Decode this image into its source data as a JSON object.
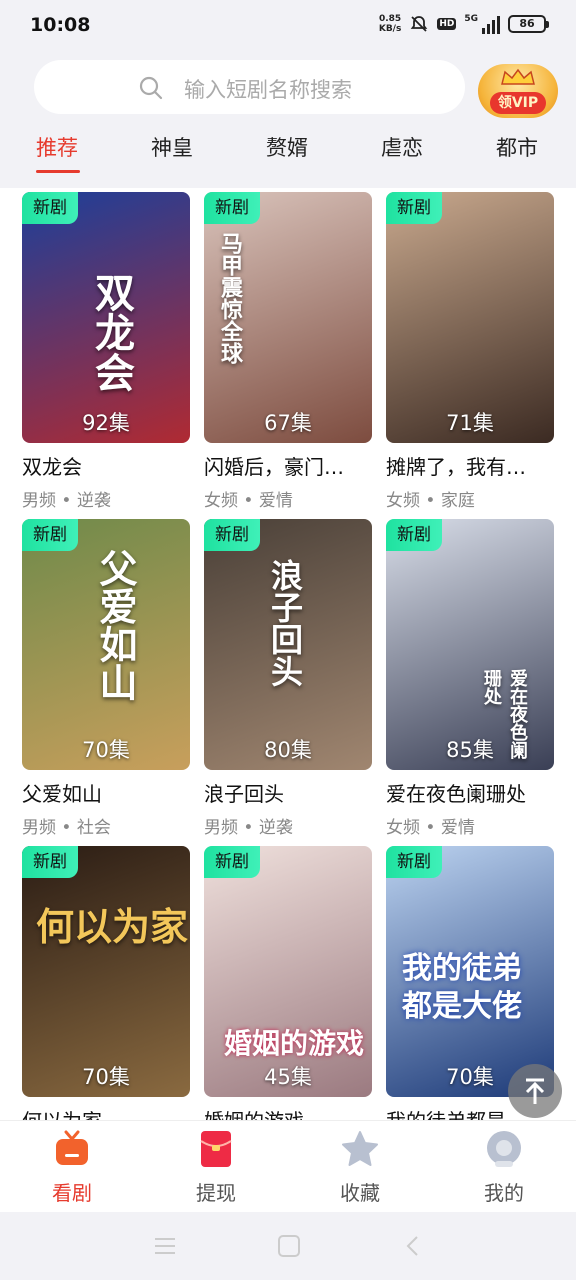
{
  "status_bar": {
    "time": "10:08",
    "net_speed_value": "0.85",
    "net_speed_unit": "KB/s",
    "hd": "HD",
    "network": "5G",
    "battery": "86"
  },
  "search": {
    "placeholder": "输入短剧名称搜索"
  },
  "vip_button": {
    "label": "领VIP"
  },
  "tabs": [
    {
      "label": "推荐",
      "active": true
    },
    {
      "label": "神皇"
    },
    {
      "label": "赘婿"
    },
    {
      "label": "虐恋"
    },
    {
      "label": "都市"
    }
  ],
  "dramas": [
    {
      "badge": "新剧",
      "episodes": "92集",
      "title": "双龙会",
      "tags": "男频 • 逆袭",
      "poster_text": "双龙会",
      "color_a": "#1c3f9a",
      "color_b": "#b02a32"
    },
    {
      "badge": "新剧",
      "episodes": "67集",
      "title": "闪婚后，豪门…",
      "tags": "女频 • 爱情",
      "poster_text": "马甲震惊全球",
      "color_a": "#d9c3bb",
      "color_b": "#7d4c3f"
    },
    {
      "badge": "新剧",
      "episodes": "71集",
      "title": "摊牌了，我有…",
      "tags": "女频 • 家庭",
      "poster_text": "",
      "color_a": "#c9a98e",
      "color_b": "#3b2a22"
    },
    {
      "badge": "新剧",
      "episodes": "70集",
      "title": "父爱如山",
      "tags": "男频 • 社会",
      "poster_text": "父爱如山",
      "color_a": "#6f8a4a",
      "color_b": "#c89f5c"
    },
    {
      "badge": "新剧",
      "episodes": "80集",
      "title": "浪子回头",
      "tags": "男频 • 逆袭",
      "poster_text": "浪子回头",
      "color_a": "#4a4038",
      "color_b": "#a08670"
    },
    {
      "badge": "新剧",
      "episodes": "85集",
      "title": "爱在夜色阑珊处",
      "tags": "女频 • 爱情",
      "poster_text": "爱在夜色阑珊处",
      "color_a": "#d8dde8",
      "color_b": "#3a3f55"
    },
    {
      "badge": "新剧",
      "episodes": "70集",
      "title": "何以为家",
      "tags": "",
      "poster_text": "何以为家",
      "color_a": "#2a1c14",
      "color_b": "#8a6a40"
    },
    {
      "badge": "新剧",
      "episodes": "45集",
      "title": "婚姻的游戏",
      "tags": "",
      "poster_text": "婚姻的游戏",
      "color_a": "#efe0dc",
      "color_b": "#9b7a80"
    },
    {
      "badge": "新剧",
      "episodes": "70集",
      "title": "我的徒弟都是…",
      "tags": "",
      "poster_text": "我的徒弟都是大佬",
      "color_a": "#bcd3f0",
      "color_b": "#1d3a78"
    }
  ],
  "bottom_nav": [
    {
      "label": "看剧",
      "icon": "tv-icon",
      "active": true
    },
    {
      "label": "提现",
      "icon": "red-envelope-icon"
    },
    {
      "label": "收藏",
      "icon": "star-icon"
    },
    {
      "label": "我的",
      "icon": "profile-icon"
    }
  ],
  "colors": {
    "accent": "#e63b2e",
    "badge": "#1fe2a0",
    "background": "#f2f2f6"
  }
}
